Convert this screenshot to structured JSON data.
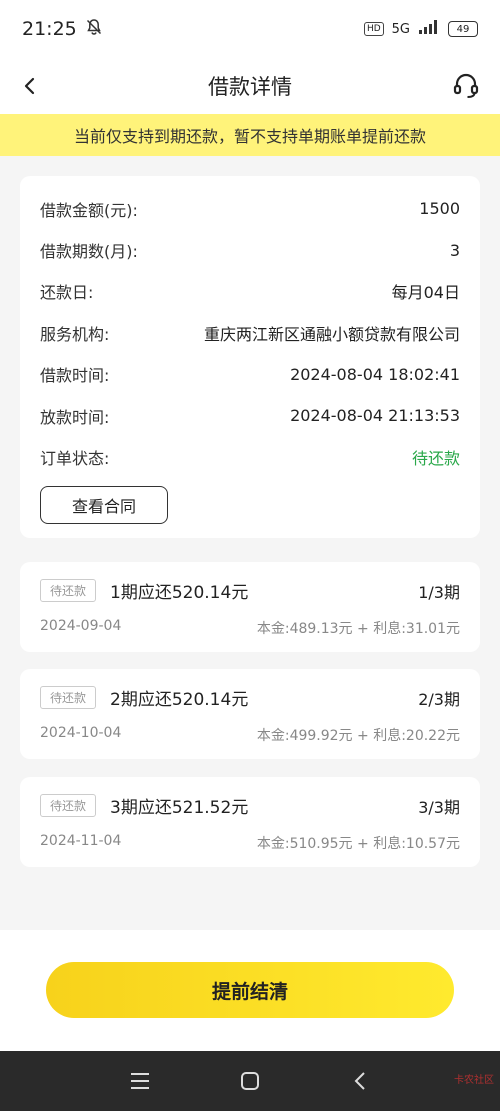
{
  "status_bar": {
    "time": "21:25",
    "hd": "HD",
    "network": "5G",
    "battery": "49"
  },
  "nav": {
    "title": "借款详情",
    "back_icon": "back-arrow-icon",
    "service_icon": "headset-icon"
  },
  "notice": {
    "text": "当前仅支持到期还款，暂不支持单期账单提前还款"
  },
  "details": {
    "rows": [
      {
        "label": "借款金额(元):",
        "value": "1500"
      },
      {
        "label": "借款期数(月):",
        "value": "3"
      },
      {
        "label": "还款日:",
        "value": "每月04日"
      },
      {
        "label": "服务机构:",
        "value": "重庆两江新区通融小额贷款有限公司"
      },
      {
        "label": "借款时间:",
        "value": "2024-08-04 18:02:41"
      },
      {
        "label": "放款时间:",
        "value": "2024-08-04 21:13:53"
      },
      {
        "label": "订单状态:",
        "value": "待还款"
      }
    ],
    "status_color": "#2aa84a",
    "contract_button": "查看合同"
  },
  "installments": [
    {
      "badge": "待还款",
      "title": "1期应还520.14元",
      "period": "1/3期",
      "date": "2024-09-04",
      "breakdown": "本金:489.13元 + 利息:31.01元"
    },
    {
      "badge": "待还款",
      "title": "2期应还520.14元",
      "period": "2/3期",
      "date": "2024-10-04",
      "breakdown": "本金:499.92元 + 利息:20.22元"
    },
    {
      "badge": "待还款",
      "title": "3期应还521.52元",
      "period": "3/3期",
      "date": "2024-11-04",
      "breakdown": "本金:510.95元 + 利息:10.57元"
    }
  ],
  "bottom": {
    "settle_button": "提前结清",
    "accent": "#f7d21b"
  },
  "system_nav": {
    "menu_icon": "menu-icon",
    "home_icon": "home-icon",
    "back_icon": "back-icon",
    "watermark": "卡农社区"
  }
}
